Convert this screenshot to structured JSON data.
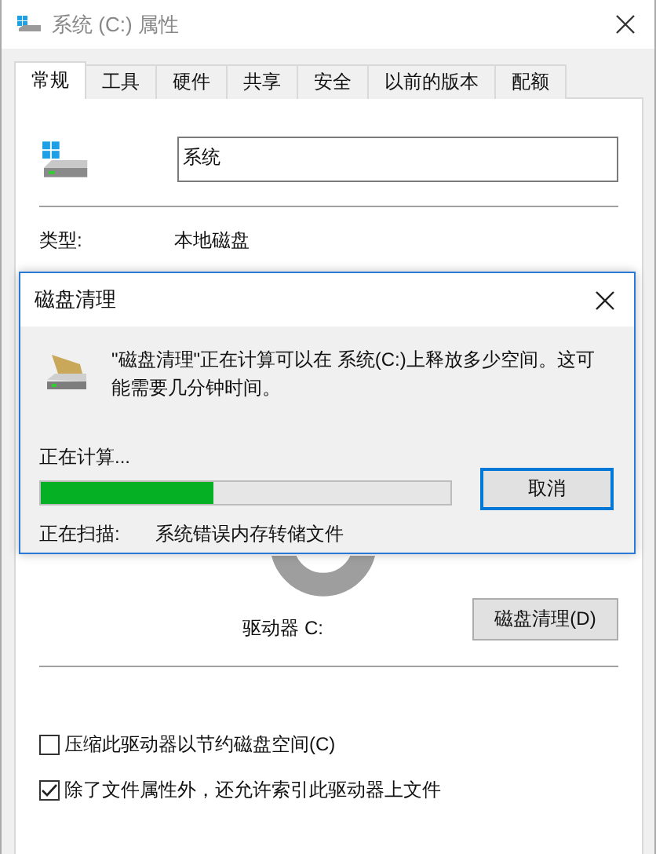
{
  "window": {
    "title": "系统 (C:) 属性"
  },
  "tabs": [
    {
      "label": "常规",
      "selected": true
    },
    {
      "label": "工具",
      "selected": false
    },
    {
      "label": "硬件",
      "selected": false
    },
    {
      "label": "共享",
      "selected": false
    },
    {
      "label": "安全",
      "selected": false
    },
    {
      "label": "以前的版本",
      "selected": false
    },
    {
      "label": "配额",
      "selected": false
    }
  ],
  "general": {
    "name_value": "系统",
    "type_label": "类型:",
    "type_value": "本地磁盘",
    "drive_label": "驱动器 C:",
    "cleanup_button": "磁盘清理(D)"
  },
  "options": [
    {
      "label": "压缩此驱动器以节约磁盘空间(C)",
      "checked": false
    },
    {
      "label": "除了文件属性外，还允许索引此驱动器上文件",
      "checked": true
    }
  ],
  "dialog": {
    "title": "磁盘清理",
    "message": "\"磁盘清理\"正在计算可以在 系统(C:)上释放多少空间。这可能需要几分钟时间。",
    "status": "正在计算...",
    "progress": {
      "level": 0.42
    },
    "cancel_button": "取消",
    "scan_label": "正在扫描:",
    "scan_item": "系统错误内存转储文件"
  }
}
